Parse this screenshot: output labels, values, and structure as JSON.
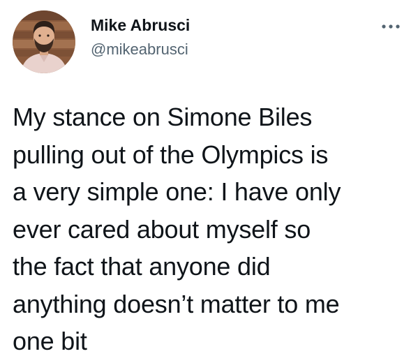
{
  "tweet": {
    "author": {
      "display_name": "Mike Abrusci",
      "handle": "@mikeabrusci",
      "avatar_icon": "user-avatar-photo"
    },
    "more_icon": "more-horizontal-icon",
    "text": "My stance on Simone Biles\npulling out of the Olympics is\na very simple one: I have only\never cared about myself so\nthe fact that anyone did\nanything doesn’t matter to me\none bit",
    "colors": {
      "text": "#0f1419",
      "secondary": "#536471",
      "background": "#ffffff"
    }
  }
}
